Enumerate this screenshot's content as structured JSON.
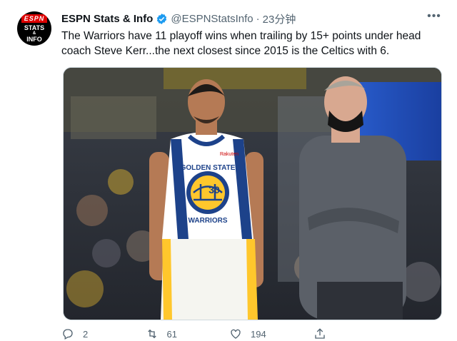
{
  "account": {
    "avatar_top": "ESPN",
    "avatar_line1": "STATS",
    "avatar_line2": "&",
    "avatar_line3": "INFO",
    "name": "ESPN Stats & Info",
    "handle": "@ESPNStatsInfo",
    "separator": "·",
    "time": "23分钟"
  },
  "tweet": {
    "text": "The Warriors have 11 playoff wins when trailing by 15+ points under head coach Steve Kerr...the next closest since 2015 is the Celtics with 6."
  },
  "media": {
    "jersey_top": "GOLDEN STATE",
    "jersey_bottom": "WARRIORS",
    "jersey_number": "30",
    "sponsor": "Rakuten"
  },
  "actions": {
    "replies": "2",
    "retweets": "61",
    "likes": "194"
  },
  "colors": {
    "verified": "#1d9bf0",
    "text_secondary": "#536471",
    "warriors_blue": "#1d428a",
    "warriors_gold": "#ffc72c"
  }
}
